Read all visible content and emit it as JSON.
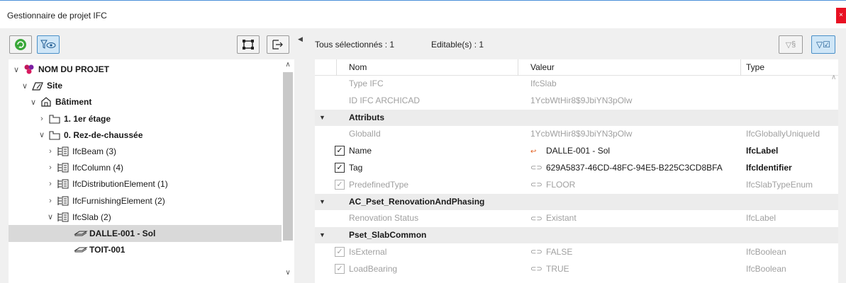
{
  "window": {
    "title": "Gestionnaire de projet IFC",
    "close": "×"
  },
  "left_toolbar": {
    "refresh_icon": "refresh-icon",
    "filter_view_icon": "filter-eye-icon",
    "structure_icon": "structure-icon",
    "export_icon": "export-icon"
  },
  "tree": {
    "items": [
      {
        "label": "NOM DU PROJET",
        "bold": true,
        "level": 0,
        "expander": "∨",
        "icon": "project-icon"
      },
      {
        "label": "Site",
        "bold": true,
        "level": 1,
        "expander": "∨",
        "icon": "site-icon"
      },
      {
        "label": "Bâtiment",
        "bold": true,
        "level": 2,
        "expander": "∨",
        "icon": "building-icon"
      },
      {
        "label": "1. 1er étage",
        "bold": true,
        "level": 3,
        "expander": "›",
        "icon": "storey-icon"
      },
      {
        "label": "0. Rez-de-chaussée",
        "bold": true,
        "level": 3,
        "expander": "∨",
        "icon": "storey-icon"
      },
      {
        "label": "IfcBeam (3)",
        "bold": false,
        "level": 4,
        "expander": "›",
        "icon": "ifc-type-icon"
      },
      {
        "label": "IfcColumn (4)",
        "bold": false,
        "level": 4,
        "expander": "›",
        "icon": "ifc-type-icon"
      },
      {
        "label": "IfcDistributionElement (1)",
        "bold": false,
        "level": 4,
        "expander": "›",
        "icon": "ifc-type-icon"
      },
      {
        "label": "IfcFurnishingElement (2)",
        "bold": false,
        "level": 4,
        "expander": "›",
        "icon": "ifc-type-icon"
      },
      {
        "label": "IfcSlab (2)",
        "bold": false,
        "level": 4,
        "expander": "∨",
        "icon": "ifc-type-icon"
      },
      {
        "label": "DALLE-001 - Sol",
        "bold": true,
        "level": 6,
        "expander": "",
        "icon": "element-icon",
        "selected": true
      },
      {
        "label": "TOIT-001",
        "bold": true,
        "level": 6,
        "expander": "",
        "icon": "element-icon"
      }
    ]
  },
  "status": {
    "selected": "Tous sélectionnés : 1",
    "editable": "Editable(s) : 1"
  },
  "right_toolbar": {
    "filter_hidden_label": "§",
    "filter_checked_label": "☑"
  },
  "properties": {
    "columns": {
      "name": "Nom",
      "value": "Valeur",
      "type": "Type"
    },
    "rows": [
      {
        "kind": "prop",
        "name": "Type IFC",
        "value": "IfcSlab",
        "type": "",
        "checkbox": "none",
        "grey": true,
        "value_icon": ""
      },
      {
        "kind": "prop",
        "name": "ID IFC ARCHICAD",
        "value": "1YcbWtHir8$9JbiYN3pOlw",
        "type": "",
        "checkbox": "none",
        "grey": true,
        "value_icon": ""
      },
      {
        "kind": "group",
        "name": "Attributs"
      },
      {
        "kind": "prop",
        "name": "GlobalId",
        "value": "1YcbWtHir8$9JbiYN3pOlw",
        "type": "IfcGloballyUniqueId",
        "checkbox": "none",
        "grey": true,
        "value_icon": ""
      },
      {
        "kind": "prop",
        "name": "Name",
        "value": "DALLE-001 - Sol",
        "type": "IfcLabel",
        "checkbox": "checked",
        "grey": false,
        "value_icon": "↩"
      },
      {
        "kind": "prop",
        "name": "Tag",
        "value": "629A5837-46CD-48FC-94E5-B225C3CD8BFA",
        "type": "IfcIdentifier",
        "checkbox": "checked",
        "grey": false,
        "value_icon": "⊂⊃"
      },
      {
        "kind": "prop",
        "name": "PredefinedType",
        "value": "FLOOR",
        "type": "IfcSlabTypeEnum",
        "checkbox": "disabled",
        "grey": true,
        "value_icon": "⊂⊃"
      },
      {
        "kind": "group",
        "name": "AC_Pset_RenovationAndPhasing"
      },
      {
        "kind": "prop",
        "name": "Renovation Status",
        "value": "Existant",
        "type": "IfcLabel",
        "checkbox": "none",
        "grey": true,
        "value_icon": "⊂⊃"
      },
      {
        "kind": "group",
        "name": "Pset_SlabCommon"
      },
      {
        "kind": "prop",
        "name": "IsExternal",
        "value": "FALSE",
        "type": "IfcBoolean",
        "checkbox": "disabled",
        "grey": true,
        "value_icon": "⊂⊃"
      },
      {
        "kind": "prop",
        "name": "LoadBearing",
        "value": "TRUE",
        "type": "IfcBoolean",
        "checkbox": "disabled",
        "grey": true,
        "value_icon": "⊂⊃"
      }
    ]
  }
}
